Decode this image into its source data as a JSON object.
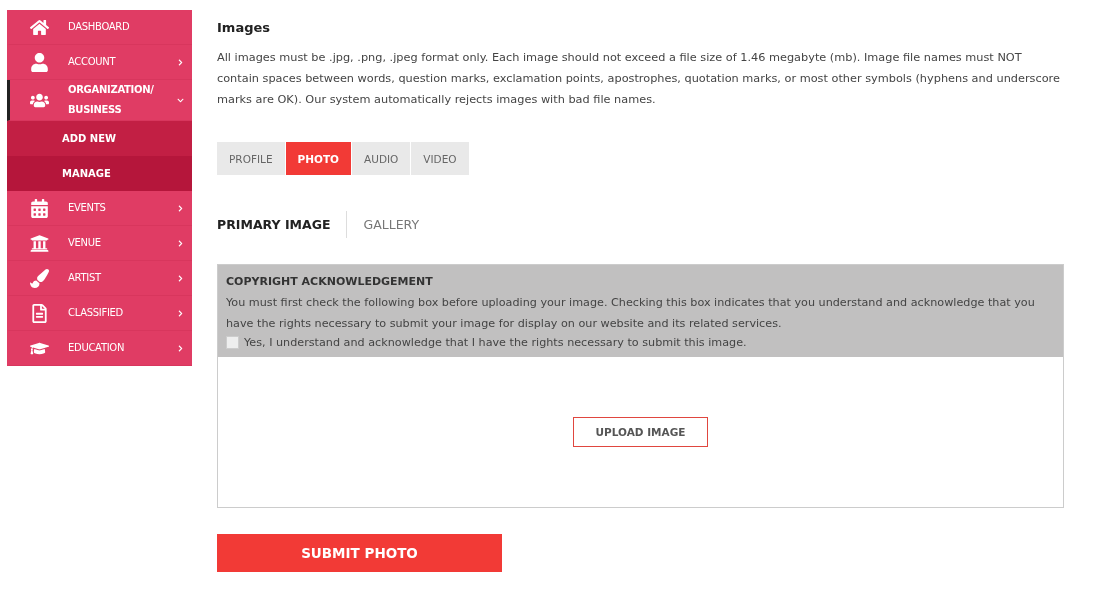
{
  "sidebar": {
    "items": [
      {
        "label": "DASHBOARD",
        "selected": false
      },
      {
        "label": "ACCOUNT",
        "selected": false,
        "expanded": false
      },
      {
        "label": "ORGANIZATION/ BUSINESS",
        "selected": true,
        "expanded": true,
        "children": [
          {
            "label": "ADD NEW",
            "selected": false
          },
          {
            "label": "MANAGE",
            "selected": true
          }
        ]
      },
      {
        "label": "EVENTS",
        "selected": false,
        "expanded": false
      },
      {
        "label": "VENUE",
        "selected": false,
        "expanded": false
      },
      {
        "label": "ARTIST",
        "selected": false,
        "expanded": false
      },
      {
        "label": "CLASSIFIED",
        "selected": false,
        "expanded": false
      },
      {
        "label": "EDUCATION",
        "selected": false,
        "expanded": false
      }
    ]
  },
  "heading": "Images",
  "intro": "All images must be .jpg, .png, .jpeg format only. Each image should not exceed a file size of 1.46 megabyte (mb). Image file names must NOT contain spaces between words, question marks, exclamation points, apostrophes, quotation marks, or most other symbols (hyphens and underscore marks are OK). Our system automatically rejects images with bad file names.",
  "tabs": [
    {
      "label": "PROFILE",
      "selected": false
    },
    {
      "label": "PHOTO",
      "selected": true
    },
    {
      "label": "AUDIO",
      "selected": false
    },
    {
      "label": "VIDEO",
      "selected": false
    }
  ],
  "subtabs": [
    {
      "label": "PRIMARY IMAGE",
      "selected": true
    },
    {
      "label": "GALLERY",
      "selected": false
    }
  ],
  "copyright": {
    "title": "COPYRIGHT ACKNOWLEDGEMENT",
    "text": "You must first check the following box before uploading your image. Checking this box indicates that you understand and acknowledge that you have the rights necessary to submit your image for display on our website and its related services.",
    "checkbox": {
      "label": "Yes, I understand and acknowledge that I have the rights necessary to submit this image.",
      "checked": false
    }
  },
  "upload_button": "UPLOAD IMAGE",
  "submit_button": "SUBMIT PHOTO"
}
